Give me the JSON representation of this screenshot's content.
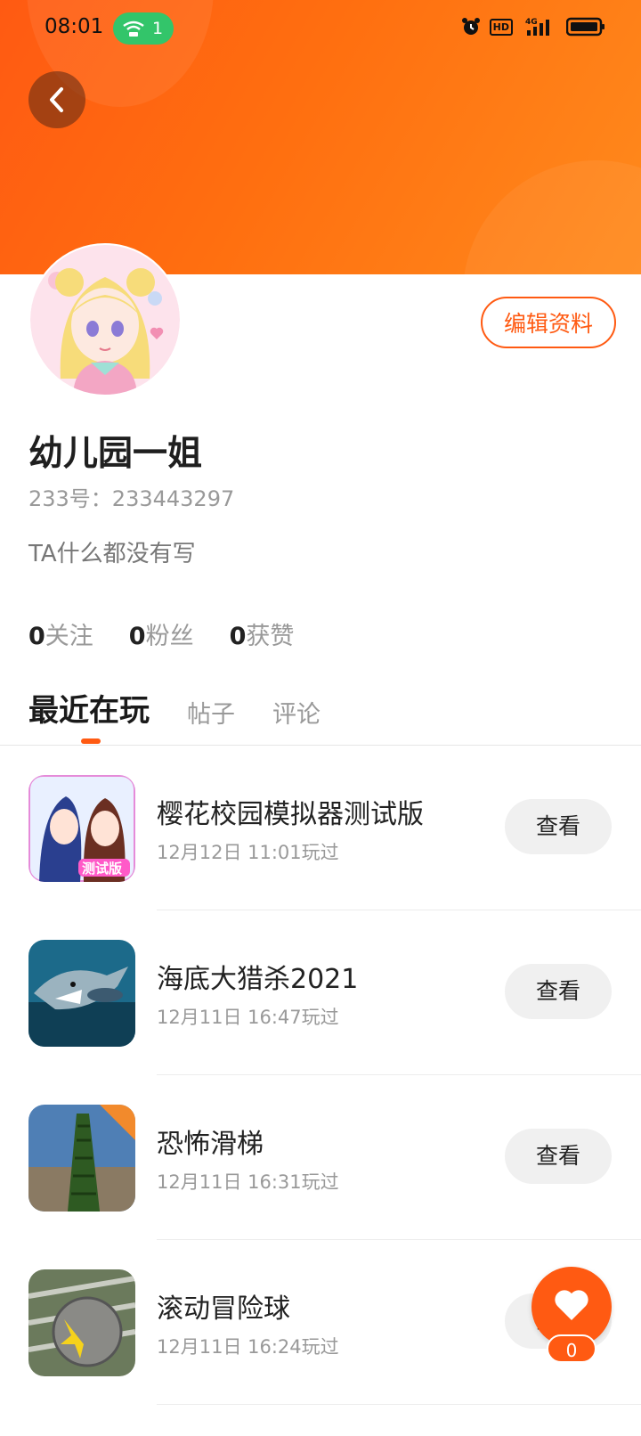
{
  "status_bar": {
    "time": "08:01",
    "hotspot_count": "1",
    "hd_label": "HD",
    "network": "4G"
  },
  "profile": {
    "edit_label": "编辑资料",
    "nickname": "幼儿园一姐",
    "uid": "233号：233443297",
    "bio": "TA什么都没有写",
    "stats": [
      {
        "num": "0",
        "label": "关注"
      },
      {
        "num": "0",
        "label": "粉丝"
      },
      {
        "num": "0",
        "label": "获赞"
      }
    ]
  },
  "tabs": [
    "最近在玩",
    "帖子",
    "评论"
  ],
  "active_tab": "最近在玩",
  "games": [
    {
      "title": "樱花校园模拟器测试版",
      "time": "12月12日 11:01玩过",
      "button": "查看",
      "icon": "sakura-school-icon"
    },
    {
      "title": "海底大猎杀2021",
      "time": "12月11日 16:47玩过",
      "button": "查看",
      "icon": "shark-game-icon"
    },
    {
      "title": "恐怖滑梯",
      "time": "12月11日 16:31玩过",
      "button": "查看",
      "icon": "horror-slide-icon"
    },
    {
      "title": "滚动冒险球",
      "time": "12月11日 16:24玩过",
      "button": "查看",
      "icon": "rolling-ball-icon"
    }
  ],
  "like_fab": {
    "count": "0"
  },
  "colors": {
    "accent": "#ff5a12",
    "header_gradient_start": "#ff5a12",
    "header_gradient_end": "#ff8a1c"
  }
}
